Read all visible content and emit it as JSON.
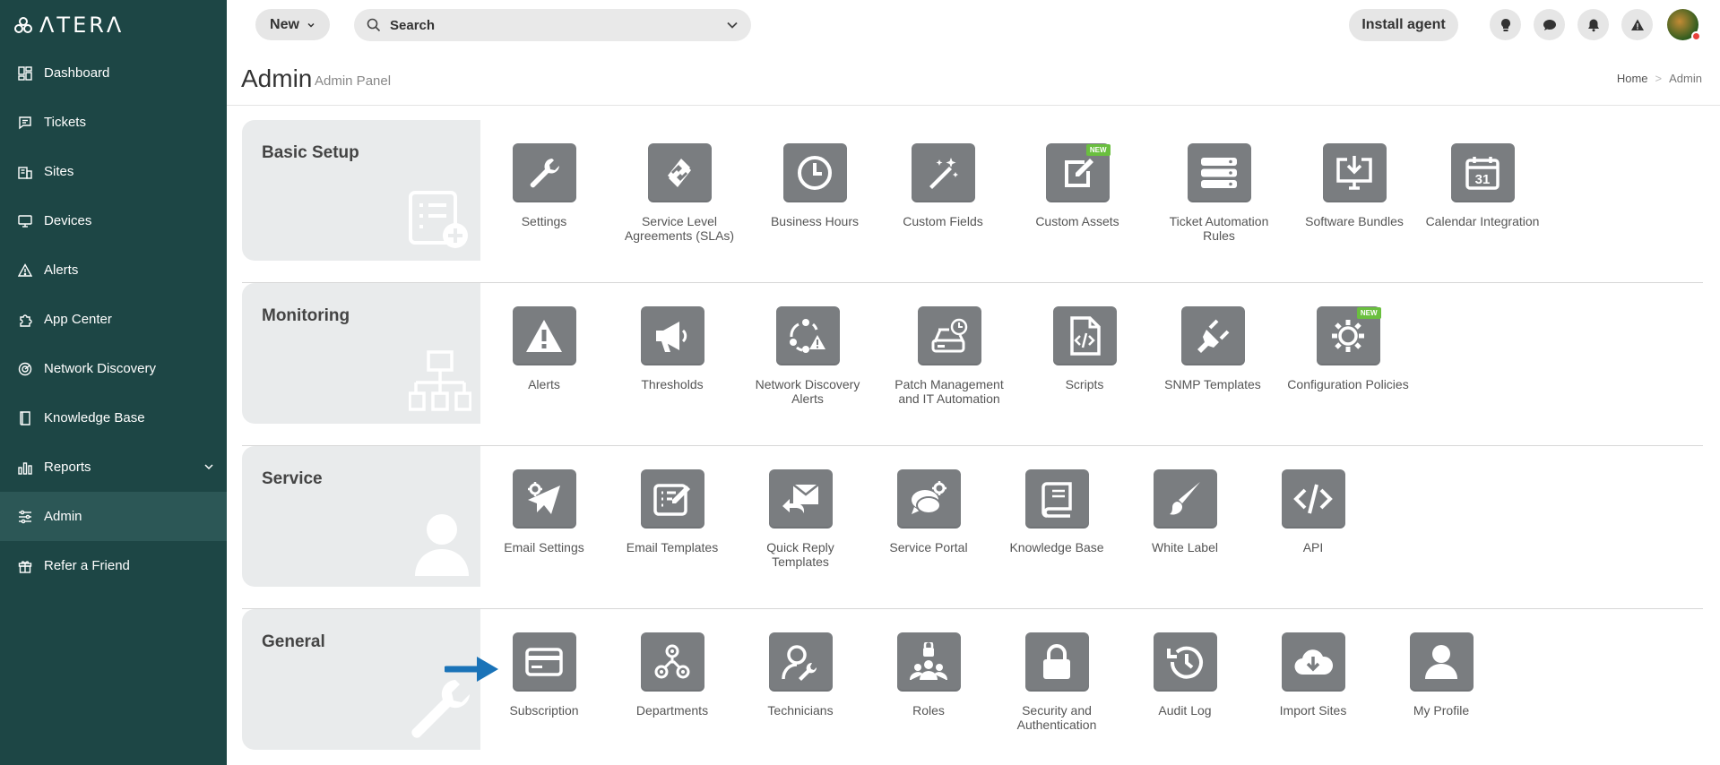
{
  "brand": {
    "logo_text": "ΛTERΛ",
    "colors": {
      "sidebar": "#1d4645",
      "sidebar_active": "#2c5756",
      "tile": "#7a7d80",
      "badge": "#6abf3f",
      "arrow": "#1a73b8"
    }
  },
  "sidebar": {
    "items": [
      {
        "label": "Dashboard",
        "icon": "dashboard-icon"
      },
      {
        "label": "Tickets",
        "icon": "ticket-icon"
      },
      {
        "label": "Sites",
        "icon": "building-icon"
      },
      {
        "label": "Devices",
        "icon": "monitor-icon"
      },
      {
        "label": "Alerts",
        "icon": "warning-icon"
      },
      {
        "label": "App Center",
        "icon": "puzzle-icon"
      },
      {
        "label": "Network Discovery",
        "icon": "radar-icon"
      },
      {
        "label": "Knowledge Base",
        "icon": "book-icon"
      },
      {
        "label": "Reports",
        "icon": "bar-chart-icon"
      },
      {
        "label": "Admin",
        "icon": "sliders-icon",
        "active": true
      },
      {
        "label": "Refer a Friend",
        "icon": "gift-icon"
      }
    ]
  },
  "topbar": {
    "new_label": "New",
    "search_label": "Search",
    "install_label": "Install agent"
  },
  "header": {
    "title": "Admin",
    "subtitle": "Admin Panel",
    "breadcrumb": [
      "Home",
      "Admin"
    ]
  },
  "sections": [
    {
      "title": "Basic Setup",
      "tiles": [
        {
          "label": "Settings",
          "icon": "wrench-icon"
        },
        {
          "label": "Service Level Agreements (SLAs)",
          "icon": "sla-icon"
        },
        {
          "label": "Business Hours",
          "icon": "clock-icon"
        },
        {
          "label": "Custom Fields",
          "icon": "magic-wand-icon"
        },
        {
          "label": "Custom Assets",
          "icon": "edit-icon",
          "badge": "NEW"
        },
        {
          "label": "Ticket Automation Rules",
          "icon": "server-stack-icon"
        },
        {
          "label": "Software Bundles",
          "icon": "download-monitor-icon"
        },
        {
          "label": "Calendar Integration",
          "icon": "calendar-icon"
        }
      ]
    },
    {
      "title": "Monitoring",
      "tiles": [
        {
          "label": "Alerts",
          "icon": "warning-icon"
        },
        {
          "label": "Thresholds",
          "icon": "megaphone-icon"
        },
        {
          "label": "Network Discovery Alerts",
          "icon": "network-alert-icon"
        },
        {
          "label": "Patch Management and IT Automation",
          "icon": "patch-icon"
        },
        {
          "label": "Scripts",
          "icon": "code-file-icon"
        },
        {
          "label": "SNMP Templates",
          "icon": "plug-icon"
        },
        {
          "label": "Configuration Policies",
          "icon": "gear-icon",
          "badge": "NEW"
        }
      ]
    },
    {
      "title": "Service",
      "tiles": [
        {
          "label": "Email Settings",
          "icon": "send-gear-icon"
        },
        {
          "label": "Email Templates",
          "icon": "template-edit-icon"
        },
        {
          "label": "Quick Reply Templates",
          "icon": "reply-mail-icon"
        },
        {
          "label": "Service Portal",
          "icon": "chat-gear-icon"
        },
        {
          "label": "Knowledge Base",
          "icon": "book-icon"
        },
        {
          "label": "White Label",
          "icon": "brush-icon"
        },
        {
          "label": "API",
          "icon": "code-icon"
        }
      ]
    },
    {
      "title": "General",
      "tiles": [
        {
          "label": "Subscription",
          "icon": "credit-card-icon"
        },
        {
          "label": "Departments",
          "icon": "org-chart-icon"
        },
        {
          "label": "Technicians",
          "icon": "technician-icon"
        },
        {
          "label": "Roles",
          "icon": "roles-icon"
        },
        {
          "label": "Security and Authentication",
          "icon": "lock-icon"
        },
        {
          "label": "Audit Log",
          "icon": "history-icon"
        },
        {
          "label": "Import Sites",
          "icon": "cloud-download-icon"
        },
        {
          "label": "My Profile",
          "icon": "user-icon"
        }
      ]
    }
  ]
}
